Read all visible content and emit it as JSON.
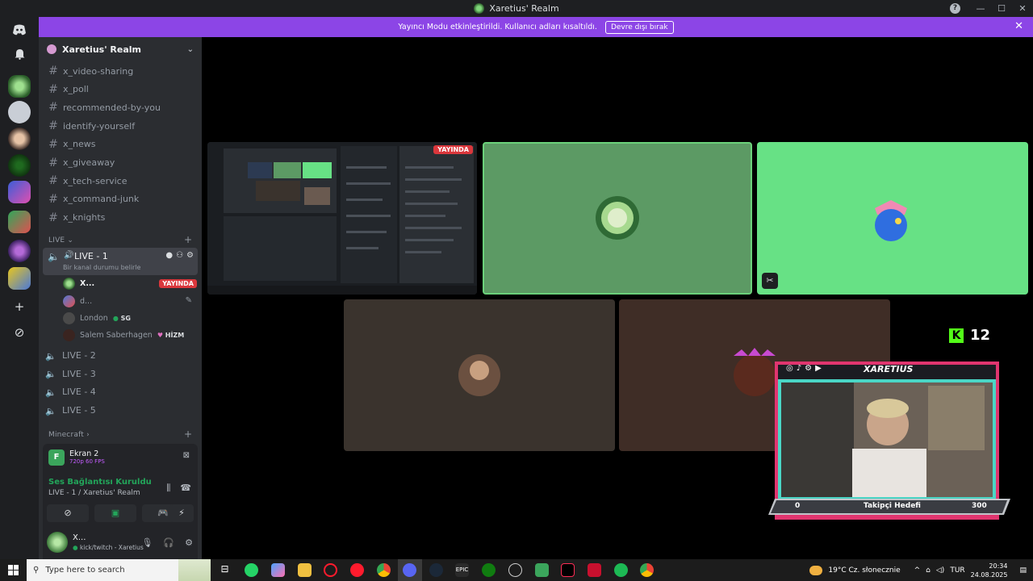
{
  "window": {
    "title": "Xaretius' Realm",
    "controls": [
      "—",
      "☐",
      "✕"
    ]
  },
  "banner": {
    "text": "Yayıncı Modu etkinleştirildi. Kullanıcı adları kısaltıldı.",
    "button": "Devre dışı bırak"
  },
  "server": {
    "name": "Xaretius' Realm"
  },
  "channels": [
    "x_video-sharing",
    "x_poll",
    "recommended-by-you",
    "identify-yourself",
    "x_news",
    "x_giveaway",
    "x_tech-service",
    "x_command-junk",
    "x_knights"
  ],
  "live_category": "LIVE",
  "live1": {
    "name": "LIVE - 1",
    "status_placeholder": "Bir kanal durumu belirle",
    "members": [
      {
        "name": "X...",
        "badge": "YAYINDA"
      },
      {
        "name": "d..."
      },
      {
        "name": "London",
        "role": "SG"
      },
      {
        "name": "Salem Saberhagen",
        "role": "HİZM"
      }
    ]
  },
  "voice_channels": [
    "LIVE - 2",
    "LIVE - 3",
    "LIVE - 4",
    "LIVE - 5"
  ],
  "minecraft_category": "Minecraft",
  "screen_share": {
    "title": "Ekran 2",
    "quality": "720p 60 FPS"
  },
  "voice": {
    "status": "Ses Bağlantısı Kuruldu",
    "location": "LIVE - 1 / Xaretius' Realm"
  },
  "user": {
    "name": "X...",
    "status": "kick/twitch - Xaretius"
  },
  "stream_tile": {
    "badge": "YAYINDA"
  },
  "overlay": {
    "channel": "XARETIUS",
    "kick_count": "12",
    "goal_label": "Takipçi Hedefi",
    "goal_min": "0",
    "goal_max": "300"
  },
  "taskbar": {
    "search_placeholder": "Type here to search",
    "weather": "19°C  Cz. słonecznie",
    "lang": "TUR",
    "time": "20:34",
    "date": "24.08.2025"
  },
  "colors": {
    "accent": "#8c45e6",
    "live_red": "#da373c",
    "online_green": "#23a55a",
    "kick_green": "#53fc18"
  }
}
